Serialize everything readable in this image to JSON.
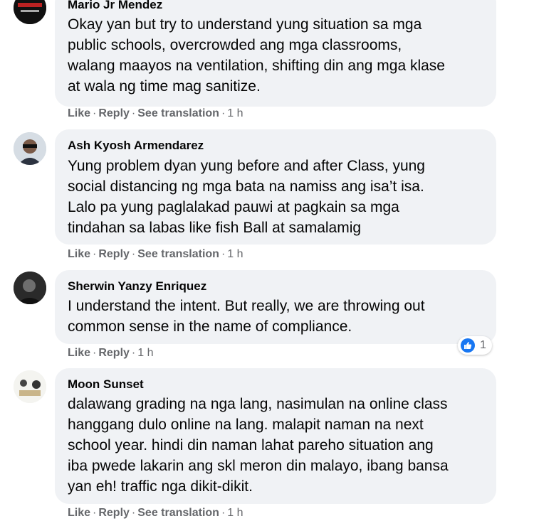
{
  "comments": [
    {
      "author": "Mario Jr Mendez",
      "text": "Okay yan but try to understand yung situation sa mga\npublic schools, overcrowded ang mga classrooms,\nwalang maayos na ventilation, shifting din ang mga klase\nat wala ng time mag sanitize.",
      "like": "Like",
      "reply": "Reply",
      "translation": "See translation",
      "time": "1 h"
    },
    {
      "author": "Ash Kyosh Armendarez",
      "text": "Yung problem dyan yung before and after Class, yung\nsocial distancing ng mga bata na namiss ang isa’t isa.\nLalo pa yung paglalakad pauwi at pagkain sa mga\ntindahan sa labas like fish Ball at samalamig",
      "like": "Like",
      "reply": "Reply",
      "translation": "See translation",
      "time": "1 h"
    },
    {
      "author": "Sherwin Yanzy Enriquez",
      "text": "I understand the intent. But really, we are throwing out\ncommon sense in the name of compliance.",
      "like": "Like",
      "reply": "Reply",
      "time": "1 h",
      "reaction_count": "1"
    },
    {
      "author": "Moon Sunset",
      "text": "dalawang grading na nga lang, nasimulan na online class\nhanggang dulo online na lang. malapit naman na next\nschool year. hindi din naman lahat pareho situation ang\niba pwede lakarin ang skl meron din malayo, ibang bansa\nyan eh! traffic nga dikit-dikit.",
      "like": "Like",
      "reply": "Reply",
      "translation": "See translation",
      "time": "1 h"
    }
  ],
  "separator": "·",
  "colors": {
    "bubble": "#f0f2f5",
    "meta": "#65676b",
    "like_blue": "#1877f2"
  }
}
